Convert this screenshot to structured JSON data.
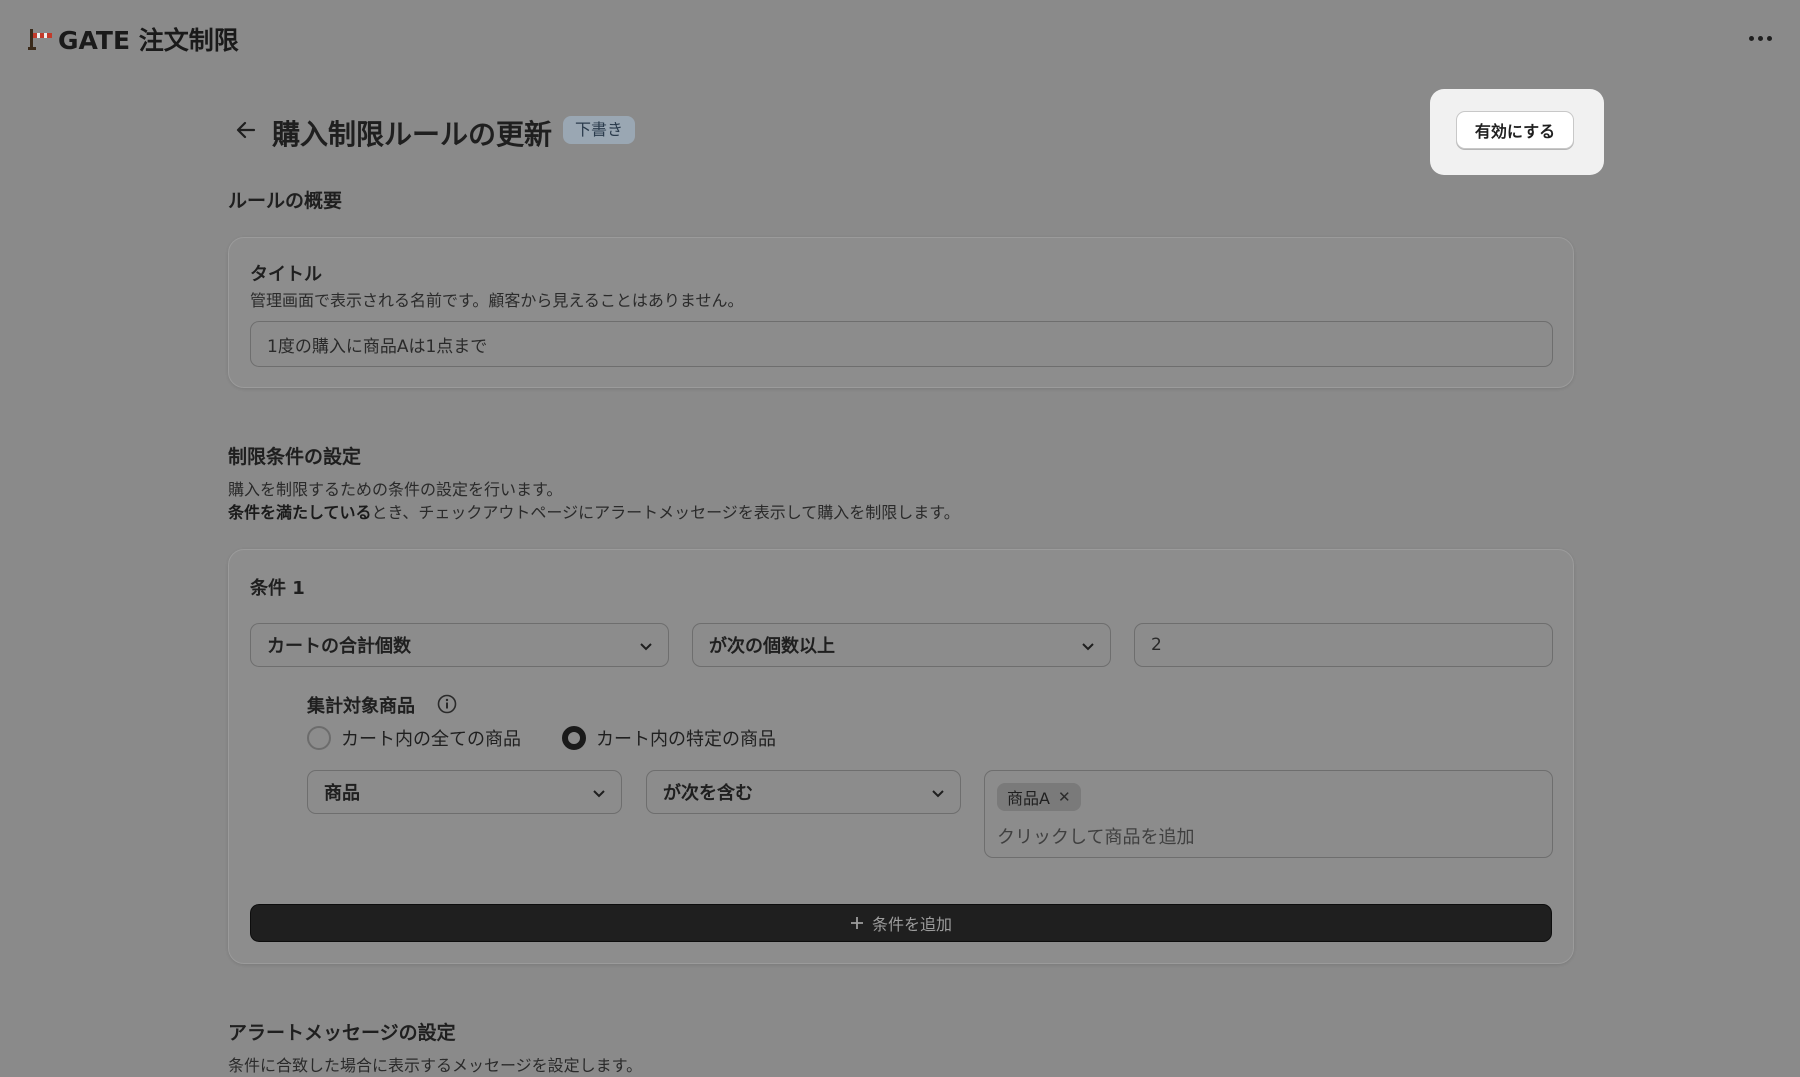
{
  "app": {
    "title": "GATE 注文制限"
  },
  "header": {
    "title": "購入制限ルールの更新",
    "badge": "下書き",
    "activate_label": "有効にする"
  },
  "overview": {
    "heading": "ルールの概要",
    "title_label": "タイトル",
    "title_help": "管理画面で表示される名前です。顧客から見えることはありません。",
    "title_value": "1度の購入に商品Aは1点まで"
  },
  "conditions": {
    "heading": "制限条件の設定",
    "desc_line1": "購入を制限するための条件の設定を行います。",
    "desc_line2_bold": "条件を満たしている",
    "desc_line2_rest": "とき、チェックアウトページにアラートメッセージを表示して購入を制限します。",
    "condition1": {
      "label": "条件 1",
      "field_select": "カートの合計個数",
      "operator_select": "が次の個数以上",
      "value": "2",
      "target_label": "集計対象商品",
      "radio_all": "カート内の全ての商品",
      "radio_specific": "カート内の特定の商品",
      "selected_radio": "specific",
      "product_field_select": "商品",
      "product_operator_select": "が次を含む",
      "tags": [
        "商品A"
      ],
      "tag_placeholder": "クリックして商品を追加"
    },
    "add_condition_label": "条件を追加"
  },
  "alert": {
    "heading": "アラートメッセージの設定",
    "desc": "条件に合致した場合に表示するメッセージを設定します。"
  }
}
